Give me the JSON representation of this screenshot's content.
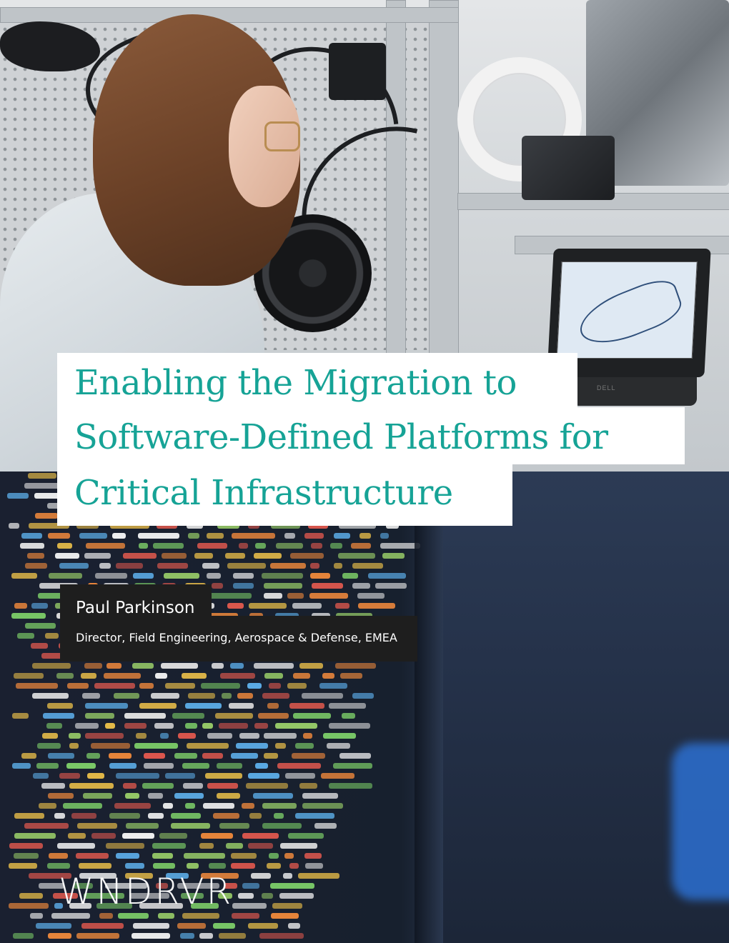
{
  "cover": {
    "title_lines": [
      "Enabling the Migration to",
      "Software-Defined Platforms for",
      "Critical Infrastructure"
    ],
    "author": {
      "name": "Paul Parkinson",
      "role": "Director, Field Engineering, Aerospace & Defense, EMEA"
    },
    "logo_text": "WNDRVR",
    "laptop_brand": "DELL",
    "colors": {
      "title": "#16a396",
      "title_box": "#ffffff",
      "author_box": "#1e1e1e",
      "author_text": "#ffffff",
      "logo": "#ffffff"
    }
  }
}
